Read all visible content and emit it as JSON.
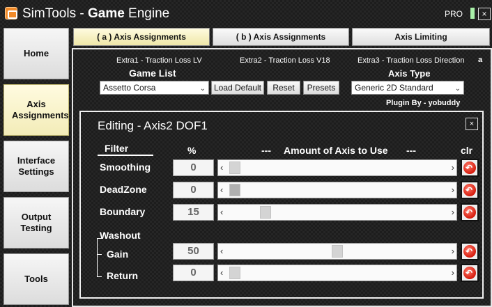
{
  "window": {
    "title_prefix": "SimTools - ",
    "title_bold": "Game",
    "title_suffix": " Engine",
    "pro_label": "PRO",
    "close_glyph": "×"
  },
  "sidebar": {
    "items": [
      {
        "label": "Home",
        "active": false
      },
      {
        "label": "Axis Assignments",
        "active": true
      },
      {
        "label": "Interface Settings",
        "active": false
      },
      {
        "label": "Output Testing",
        "active": false
      },
      {
        "label": "Tools",
        "active": false
      }
    ]
  },
  "tabs": [
    {
      "label": "( a ) Axis Assignments",
      "active": true
    },
    {
      "label": "( b ) Axis Assignments",
      "active": false
    },
    {
      "label": "Axis Limiting",
      "active": false
    }
  ],
  "plugin_bar": {
    "extra1": "Extra1 - Traction Loss LV",
    "extra2": "Extra2 - Traction Loss V18",
    "extra3": "Extra3 - Traction Loss Direction",
    "extra_flag": "a"
  },
  "game_list": {
    "heading": "Game List",
    "selected": "Assetto Corsa",
    "load_default_label": "Load Default",
    "reset_label": "Reset",
    "presets_label": "Presets"
  },
  "axis_type": {
    "heading": "Axis Type",
    "selected": "Generic 2D Standard",
    "plugin_by": "Plugin By - yobuddy"
  },
  "editor": {
    "title": "Editing - Axis2 DOF1",
    "close_glyph": "×",
    "filter_header": "Filter",
    "percent_header": "%",
    "dash_left": "---",
    "amount_header": "Amount of Axis to Use",
    "dash_right": "---",
    "clr_header": "clr",
    "washout_label": "Washout",
    "rows": [
      {
        "label": "Smoothing",
        "value": "0",
        "fraction": 0.0
      },
      {
        "label": "DeadZone",
        "value": "0",
        "fraction": 0.0
      },
      {
        "label": "Boundary",
        "value": "15",
        "fraction": 0.15
      },
      {
        "label": "Gain",
        "value": "50",
        "fraction": 0.5
      },
      {
        "label": "Return",
        "value": "0",
        "fraction": 0.0
      }
    ]
  },
  "colors": {
    "active_tab": "#f3ecb8",
    "clear_button": "#d71c0e",
    "pro_indicator": "#a8f0a8"
  },
  "icons": {
    "app": "simtools-app-icon",
    "scroll_left": "‹",
    "scroll_right": "›",
    "dropdown": "⌄"
  }
}
